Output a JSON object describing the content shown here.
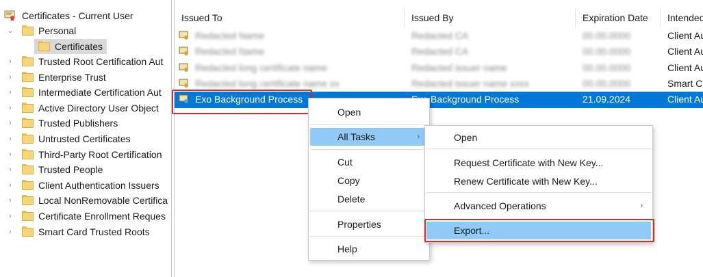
{
  "tree": {
    "root_label": "Certificates - Current User",
    "personal_label": "Personal",
    "certificates_label": "Certificates",
    "stores": [
      "Trusted Root Certification Aut",
      "Enterprise Trust",
      "Intermediate Certification Aut",
      "Active Directory User Object",
      "Trusted Publishers",
      "Untrusted Certificates",
      "Third-Party Root Certification",
      "Trusted People",
      "Client Authentication Issuers",
      "Local NonRemovable Certifica",
      "Certificate Enrollment Reques",
      "Smart Card Trusted Roots"
    ],
    "chevron_collapsed": "›",
    "chevron_expanded": "⌄"
  },
  "list": {
    "columns": [
      "Issued To",
      "Issued By",
      "Expiration Date",
      "Intended"
    ],
    "rows": [
      {
        "issued_to": "Redacted Name",
        "issued_by": "Redacted CA",
        "expiration": "00.00.0000",
        "intended": "Client Au",
        "blurred": true
      },
      {
        "issued_to": "Redacted Name",
        "issued_by": "Redacted CA",
        "expiration": "00.00.0000",
        "intended": "Client Au",
        "blurred": true
      },
      {
        "issued_to": "Redacted long certificate name",
        "issued_by": "Redacted issuer name",
        "expiration": "00.00.0000",
        "intended": "Client Au",
        "blurred": true
      },
      {
        "issued_to": "Redacted long certificate name xx",
        "issued_by": "Redacted issuer name xxxx",
        "expiration": "00.00.0000",
        "intended": "Smart Ca",
        "blurred": true
      },
      {
        "issued_to": "Exo Background Process",
        "issued_by": "Exo Background Process",
        "expiration": "21.09.2024",
        "intended": "Client Au",
        "blurred": false
      }
    ]
  },
  "context_menu": {
    "items": [
      "Open",
      "All Tasks",
      "Cut",
      "Copy",
      "Delete",
      "Properties",
      "Help"
    ]
  },
  "submenu": {
    "items": [
      "Open",
      "Request Certificate with New Key...",
      "Renew Certificate with New Key...",
      "Advanced Operations",
      "Export..."
    ]
  },
  "colors": {
    "selection": "#0078d7",
    "menu_highlight": "#91c9f7",
    "annotation_red": "#d42b2b"
  }
}
